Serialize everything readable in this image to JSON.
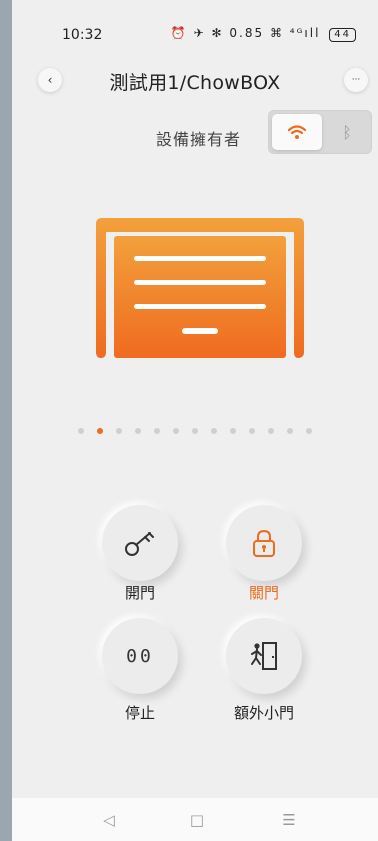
{
  "status_bar": {
    "time": "10:32",
    "icons_text": "⏰ ✈ ✻ 0.85 ⌘ ⁴ᴳıll",
    "battery": "44"
  },
  "header": {
    "back_icon": "‹",
    "title": "測試用1/ChowBOX",
    "more_icon": "···"
  },
  "owner": {
    "label": "設備擁有者",
    "wifi_icon": "wifi-icon",
    "bt_icon": "ᛒ",
    "selected": "wifi"
  },
  "carousel": {
    "count": 13,
    "active_index": 1
  },
  "controls": [
    {
      "label": "開門",
      "icon": "key-icon"
    },
    {
      "label": "關門",
      "icon": "lock-icon",
      "active": true
    },
    {
      "label": "停止",
      "icon": "pause-icon",
      "glyph": "00"
    },
    {
      "label": "額外小門",
      "icon": "person-door-icon"
    }
  ],
  "nav": {
    "back": "◁",
    "home": "□",
    "menu": "☰"
  },
  "colors": {
    "accent": "#ef6b1f",
    "gradient_top": "#f2a03c",
    "gradient_bottom": "#ef6b1f",
    "background": "#efefef"
  }
}
